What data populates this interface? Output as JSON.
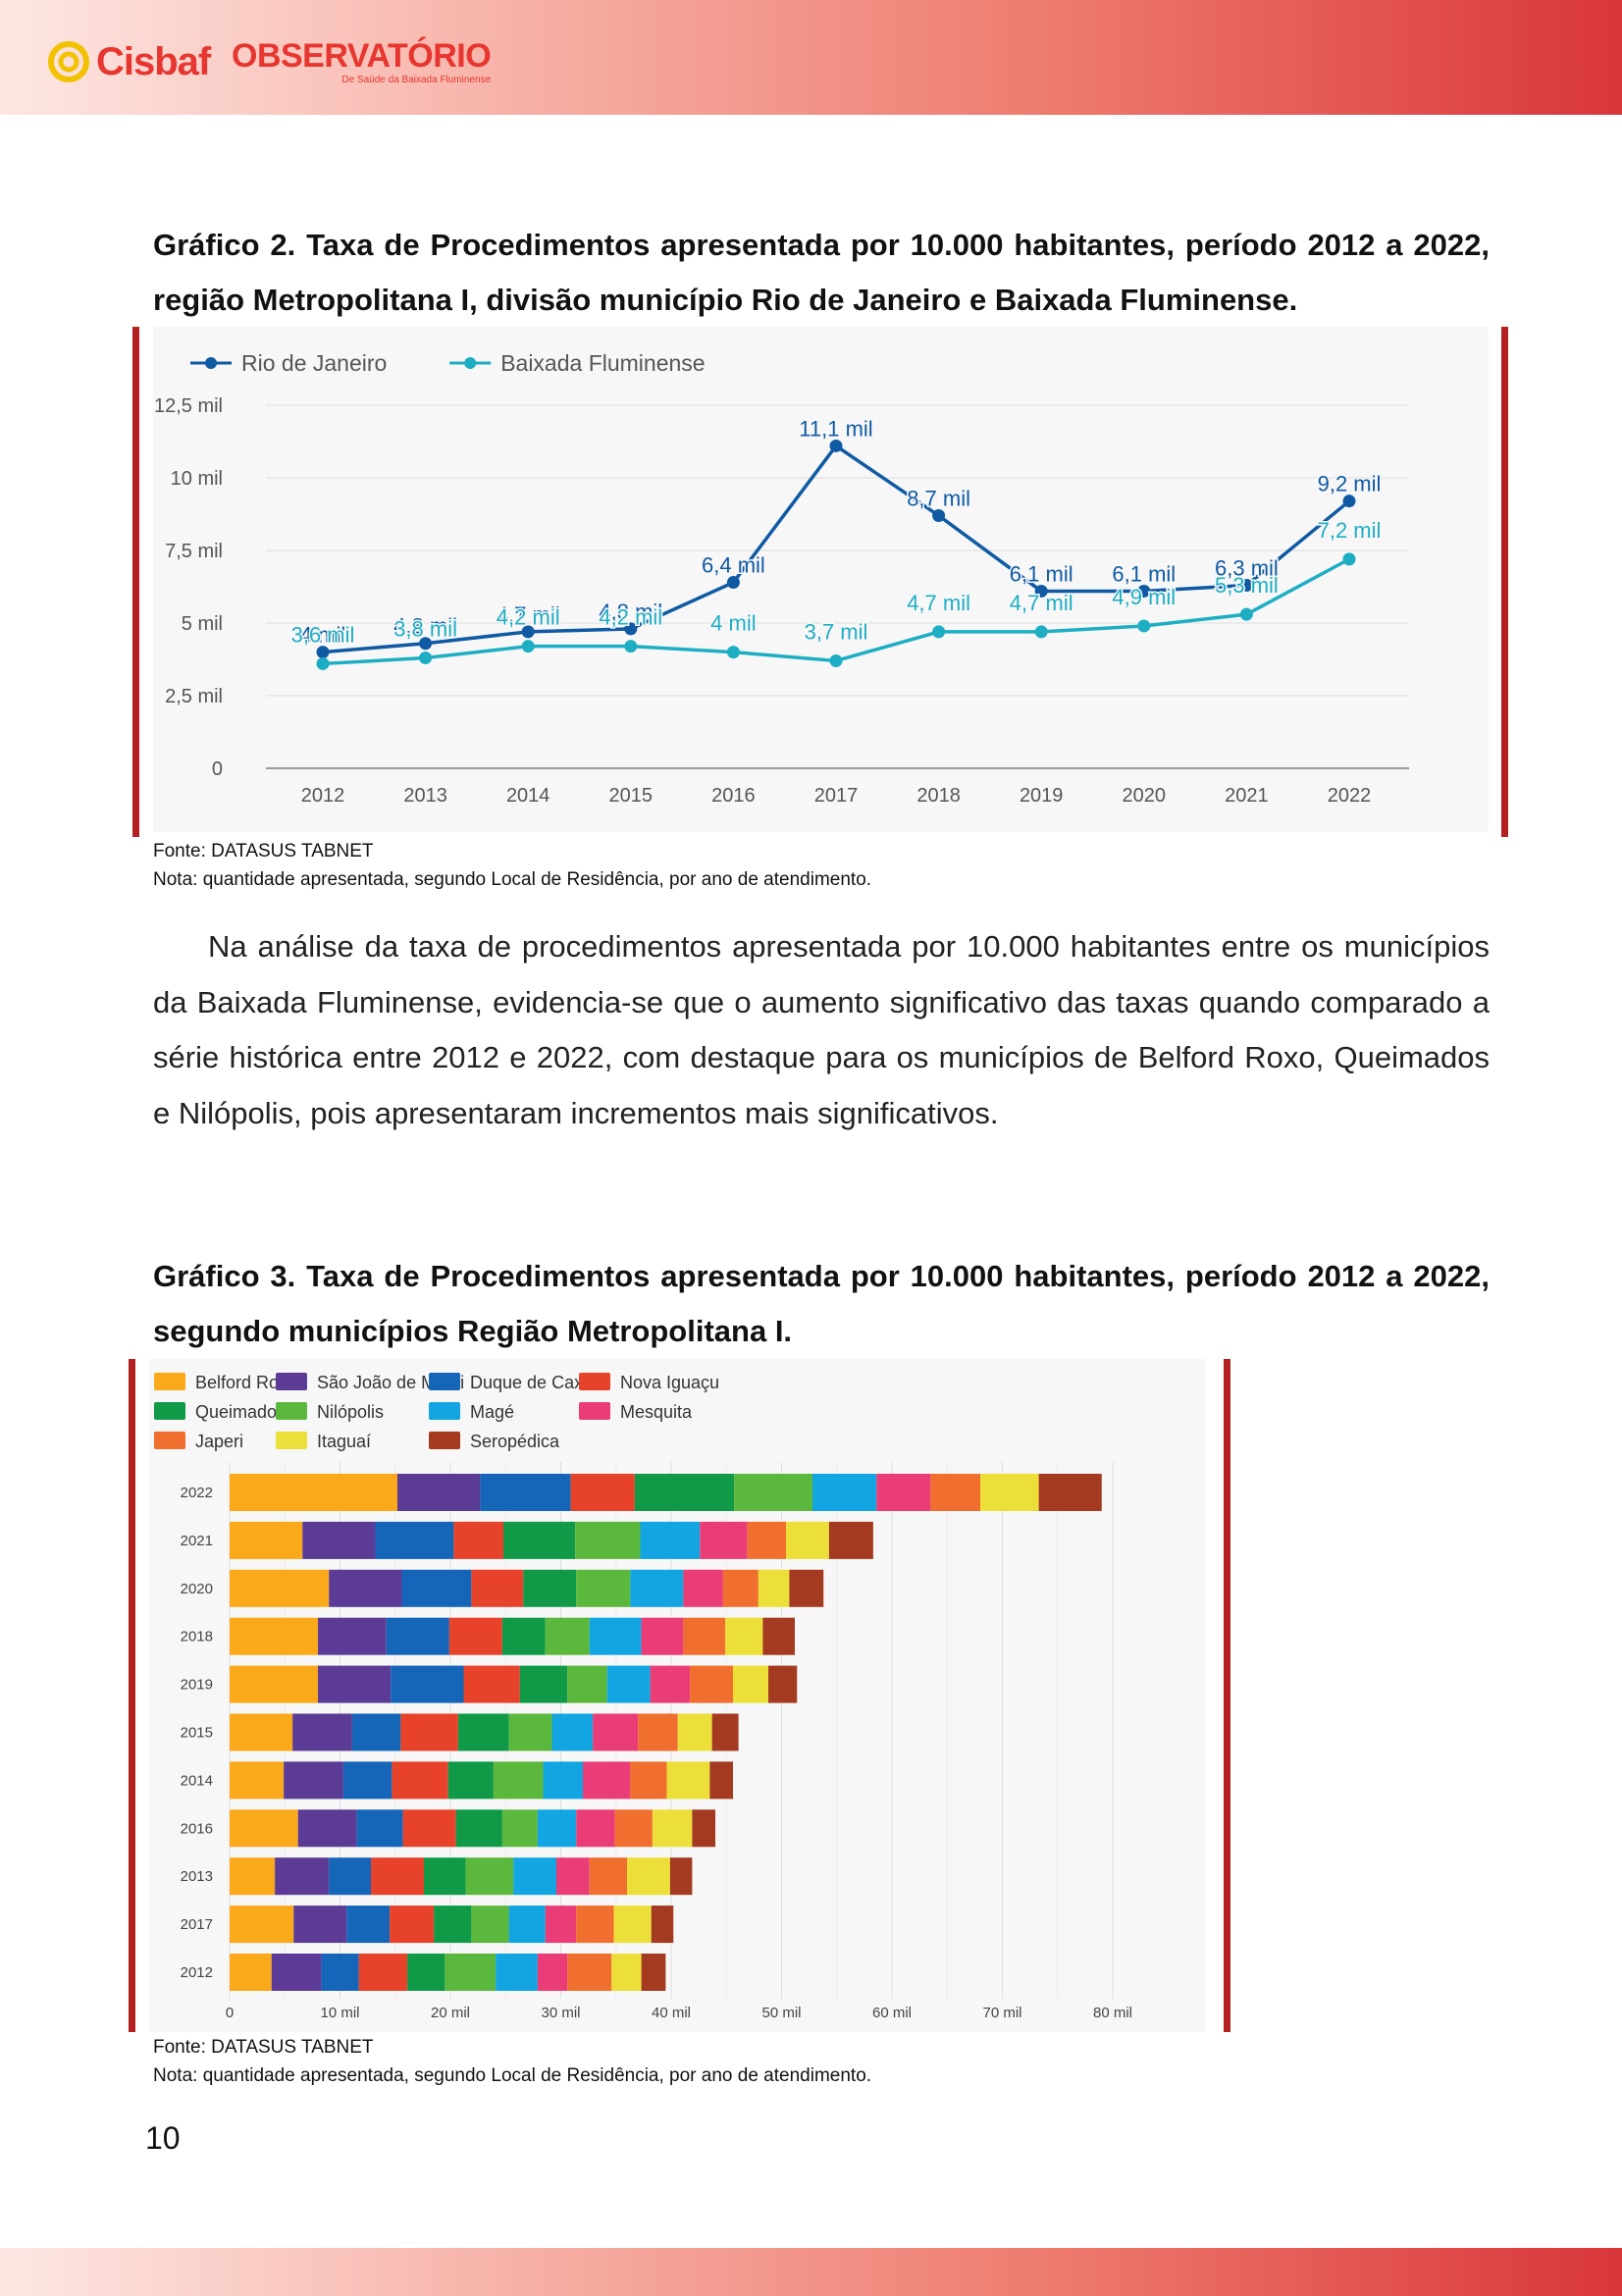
{
  "header": {
    "logo_left_text": "Cisbaf",
    "logo_right_title": "OBSERVATÓRIO",
    "logo_right_subtitle": "De Saúde da Baixada Fluminense",
    "brand_color": "#e7352f"
  },
  "chart2": {
    "caption": "Gráfico 2. Taxa de Procedimentos apresentada por 10.000 habitantes, período 2012 a 2022, região Metropolitana I, divisão município Rio de Janeiro e Baixada Fluminense.",
    "source": "Fonte: DATASUS TABNET",
    "note": "Nota: quantidade apresentada, segundo Local de Residência, por ano de atendimento."
  },
  "paragraph": "Na análise da taxa de procedimentos apresentada por 10.000 habitantes entre os municípios da Baixada Fluminense, evidencia-se que o aumento significativo das taxas quando comparado a série histórica entre 2012 e 2022, com destaque para os municípios de Belford Roxo, Queimados e Nilópolis, pois apresentaram incrementos mais significativos.",
  "chart3": {
    "caption": "Gráfico 3. Taxa de Procedimentos apresentada por 10.000 habitantes, período 2012 a 2022, segundo municípios Região Metropolitana I.",
    "source": "Fonte: DATASUS TABNET",
    "note": "Nota: quantidade apresentada, segundo Local de Residência, por ano de atendimento."
  },
  "page_number": "10",
  "chart_data": [
    {
      "type": "line",
      "x": [
        "2012",
        "2013",
        "2014",
        "2015",
        "2016",
        "2017",
        "2018",
        "2019",
        "2020",
        "2021",
        "2022"
      ],
      "series": [
        {
          "name": "Rio de Janeiro",
          "color": "#0f5aa3",
          "values": [
            4.0,
            4.3,
            4.7,
            4.8,
            6.4,
            11.1,
            8.7,
            6.1,
            6.1,
            6.3,
            9.2
          ],
          "labels": [
            "4 mil",
            "4,3 mil",
            "4,7 mil",
            "4,8 mil",
            "6,4 mil",
            "11,1 mil",
            "8,7 mil",
            "6,1 mil",
            "6,1 mil",
            "6,3 mil",
            "9,2 mil"
          ]
        },
        {
          "name": "Baixada Fluminense",
          "color": "#1eaec4",
          "values": [
            3.6,
            3.8,
            4.2,
            4.2,
            4.0,
            3.7,
            4.7,
            4.7,
            4.9,
            5.3,
            7.2
          ],
          "labels": [
            "3,6 mil",
            "3,8 mil",
            "4,2 mil",
            "4,2 mil",
            "4 mil",
            "3,7 mil",
            "4,7 mil",
            "4,7 mil",
            "4,9 mil",
            "5,3 mil",
            "7,2 mil"
          ]
        }
      ],
      "ylim": [
        0,
        12.5
      ],
      "yticks": [
        "0",
        "2,5 mil",
        "5 mil",
        "7,5 mil",
        "10 mil",
        "12,5 mil"
      ],
      "legend": "top-left",
      "grid": true
    },
    {
      "type": "bar",
      "orientation": "horizontal",
      "stacked": true,
      "categories": [
        "2022",
        "2021",
        "2020",
        "2018",
        "2019",
        "2015",
        "2014",
        "2016",
        "2013",
        "2017",
        "2012"
      ],
      "xlim": [
        0,
        85
      ],
      "xticks": [
        "0",
        "10 mil",
        "20 mil",
        "30 mil",
        "40 mil",
        "50 mil",
        "60 mil",
        "70 mil",
        "80 mil"
      ],
      "legend": "top",
      "grid": true,
      "series": [
        {
          "name": "Belford Roxo",
          "color": "#f9a91a",
          "values": [
            15.2,
            6.6,
            9.0,
            8.0,
            8.0,
            5.7,
            4.9,
            6.2,
            4.1,
            5.8,
            3.8
          ]
        },
        {
          "name": "São João de Meriti",
          "color": "#5c3b96",
          "values": [
            7.5,
            6.6,
            6.6,
            6.2,
            6.6,
            5.4,
            5.4,
            5.3,
            4.9,
            4.8,
            4.5
          ]
        },
        {
          "name": "Duque de Caxias",
          "color": "#1565b8",
          "values": [
            8.2,
            7.1,
            6.3,
            5.7,
            6.6,
            4.4,
            4.4,
            4.2,
            3.8,
            3.9,
            3.4
          ]
        },
        {
          "name": "Nova Iguaçu",
          "color": "#e6432a",
          "values": [
            5.8,
            4.5,
            4.7,
            4.8,
            5.1,
            5.2,
            5.1,
            4.8,
            4.8,
            4.0,
            4.4
          ]
        },
        {
          "name": "Queimados",
          "color": "#109a47",
          "values": [
            9.0,
            6.5,
            4.8,
            3.9,
            4.3,
            4.6,
            4.1,
            4.2,
            3.8,
            3.4,
            3.4
          ]
        },
        {
          "name": "Nilópolis",
          "color": "#5cb83c",
          "values": [
            7.1,
            5.9,
            4.9,
            4.0,
            3.6,
            3.9,
            4.5,
            3.2,
            4.3,
            3.4,
            4.6
          ]
        },
        {
          "name": "Magé",
          "color": "#12a5e1",
          "values": [
            5.8,
            5.4,
            4.8,
            4.7,
            3.9,
            3.7,
            3.6,
            3.5,
            3.9,
            3.3,
            3.8
          ]
        },
        {
          "name": "Mesquita",
          "color": "#ea3d77",
          "values": [
            4.9,
            4.3,
            3.6,
            3.8,
            3.6,
            4.1,
            4.3,
            3.5,
            3.0,
            2.8,
            2.7
          ]
        },
        {
          "name": "Japeri",
          "color": "#f06f2e",
          "values": [
            4.5,
            3.5,
            3.2,
            3.8,
            3.9,
            3.6,
            3.3,
            3.4,
            3.4,
            3.4,
            4.0
          ]
        },
        {
          "name": "Itaguaí",
          "color": "#ecdf39",
          "values": [
            5.3,
            3.9,
            2.8,
            3.4,
            3.2,
            3.1,
            3.9,
            3.6,
            3.9,
            3.4,
            2.7
          ]
        },
        {
          "name": "Seropédica",
          "color": "#a43a1f",
          "values": [
            5.7,
            4.0,
            3.1,
            2.9,
            2.6,
            2.4,
            2.1,
            2.1,
            2.0,
            2.0,
            2.2
          ]
        }
      ]
    }
  ]
}
